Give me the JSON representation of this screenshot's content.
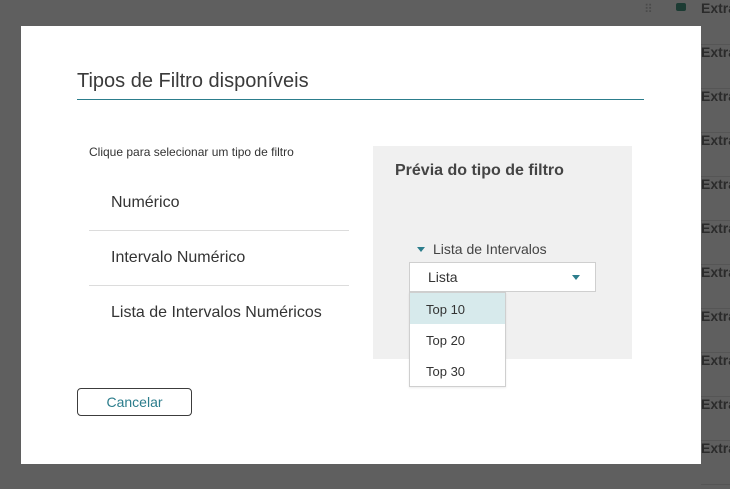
{
  "background": {
    "row_label": "Extra"
  },
  "modal": {
    "title": "Tipos de Filtro disponíveis",
    "instruction": "Clique para selecionar um tipo de filtro",
    "filter_types": [
      {
        "label": "Numérico"
      },
      {
        "label": "Intervalo Numérico"
      },
      {
        "label": "Lista de Intervalos Numéricos"
      }
    ],
    "preview": {
      "title": "Prévia do tipo de filtro",
      "list_label": "Lista de Intervalos",
      "select_value": "Lista",
      "options": [
        {
          "label": "Top 10",
          "active": true
        },
        {
          "label": "Top 20",
          "active": false
        },
        {
          "label": "Top 30",
          "active": false
        }
      ]
    },
    "cancel_label": "Cancelar"
  },
  "colors": {
    "accent": "#2c7d8c",
    "overlay": "#5f5f5f",
    "preview_bg": "#f0f0f0",
    "option_highlight": "#d7eaec"
  }
}
